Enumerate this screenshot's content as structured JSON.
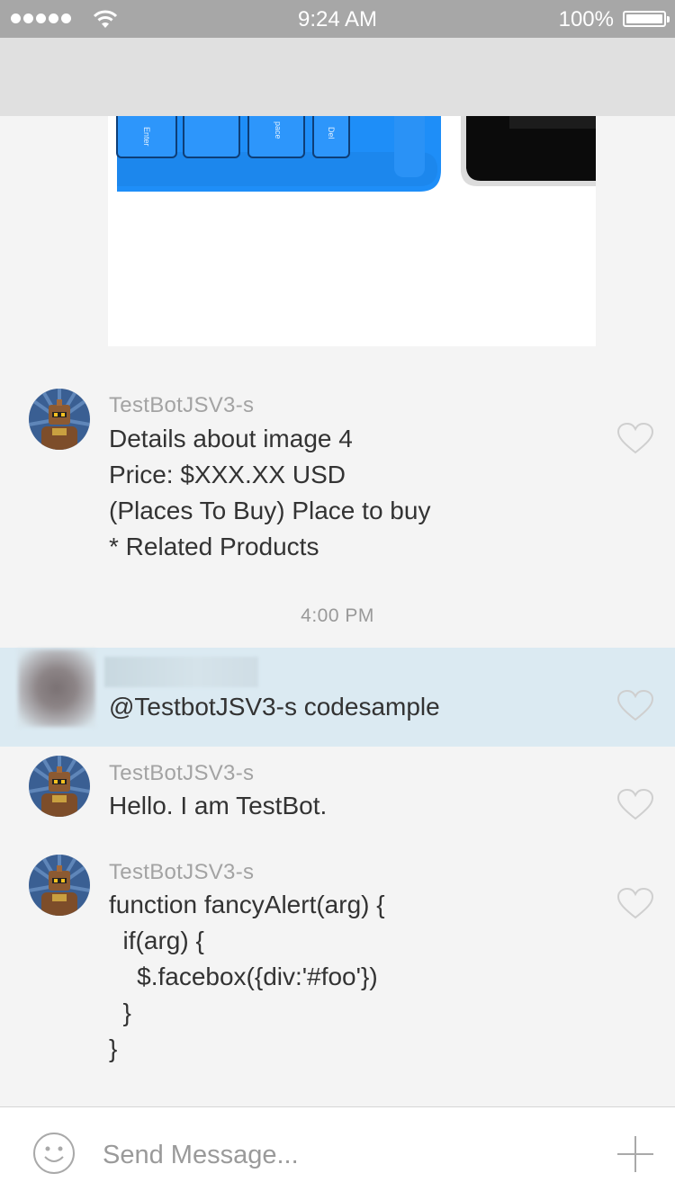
{
  "status_bar": {
    "time": "9:24 AM",
    "battery_percent": "100%",
    "signal_bars": 5
  },
  "attachment": {
    "key_labels": [
      "Enter",
      "pace",
      "Del"
    ]
  },
  "messages": [
    {
      "username": "TestBotJSV3-s",
      "text": "Details about image 4\nPrice: $XXX.XX USD\n(Places To Buy) Place to buy\n* Related Products",
      "icon": "robot-avatar-icon"
    },
    {
      "username": "",
      "text": "@TestbotJSV3-s codesample",
      "highlighted": true
    },
    {
      "username": "TestBotJSV3-s",
      "text": "Hello. I am TestBot.",
      "icon": "robot-avatar-icon"
    },
    {
      "username": "TestBotJSV3-s",
      "text": "function fancyAlert(arg) {\n  if(arg) {\n    $.facebox({div:'#foo'})\n  }\n}",
      "icon": "robot-avatar-icon"
    }
  ],
  "time_separator": "4:00 PM",
  "composer": {
    "placeholder": "Send Message..."
  },
  "colors": {
    "highlight_bg": "#dbeaf2",
    "status_bar": "#a7a7a7",
    "nav_bar": "#e0e0e0",
    "keyboard_blue": "#1e90ff"
  }
}
